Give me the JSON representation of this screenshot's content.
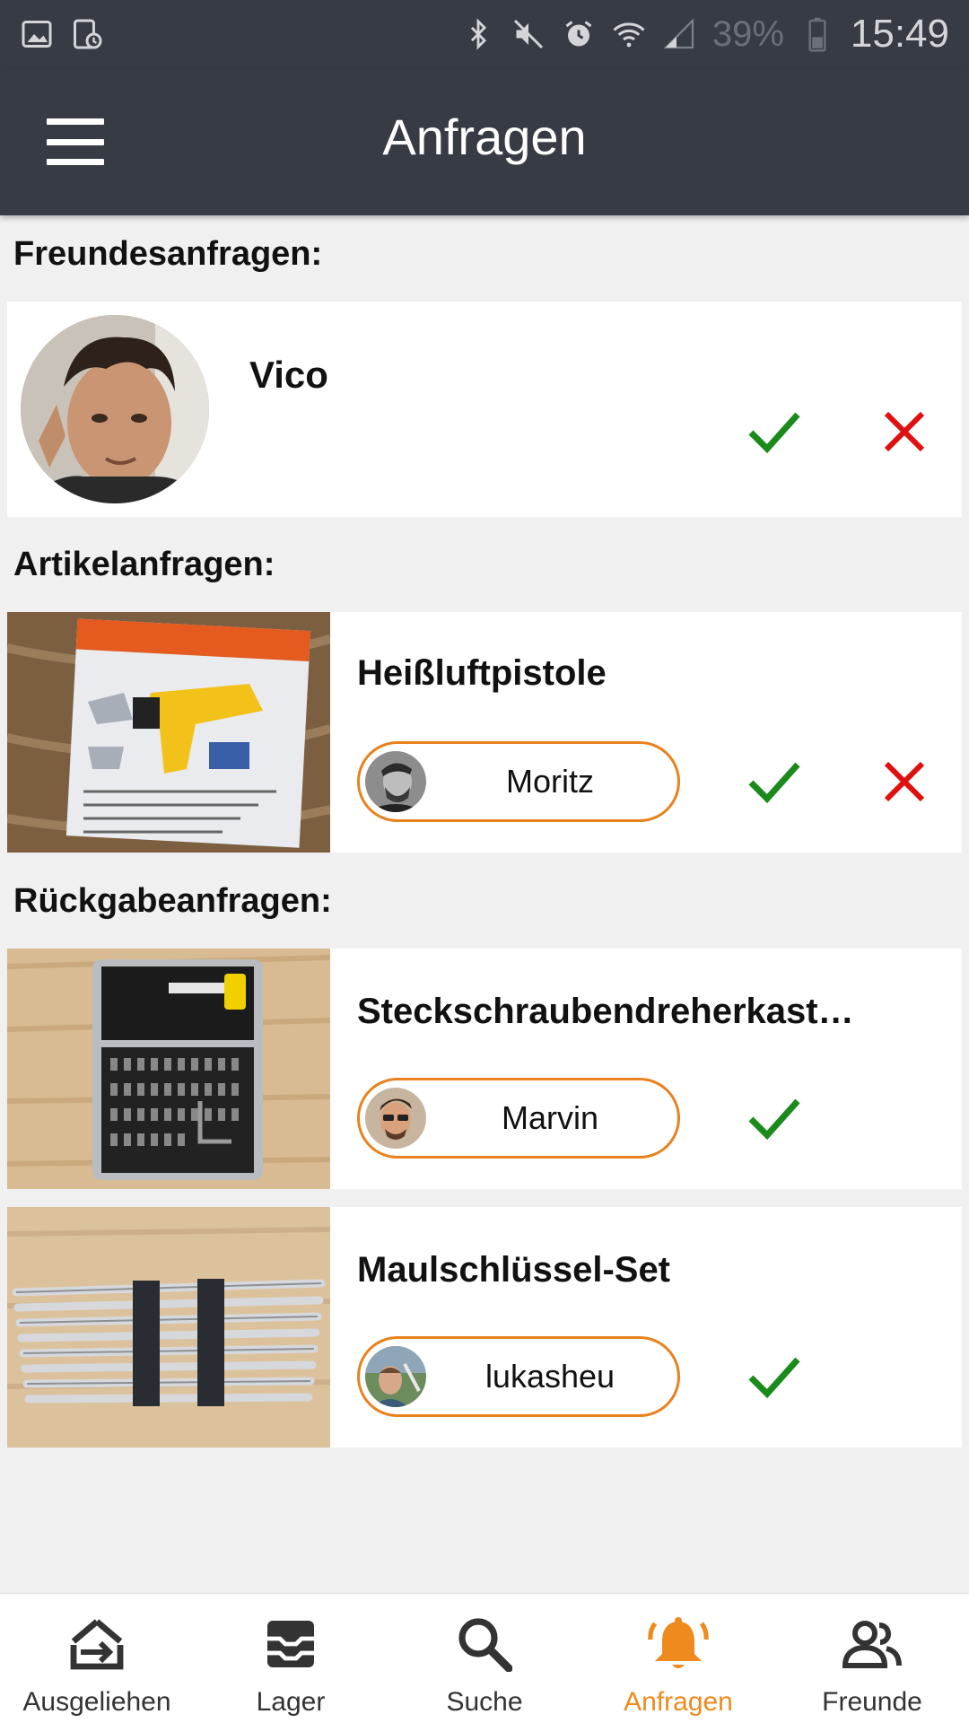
{
  "status_bar": {
    "battery": "39%",
    "time": "15:49"
  },
  "app_bar": {
    "title": "Anfragen"
  },
  "sections": {
    "friends": {
      "heading": "Freundesanfragen:",
      "items": [
        {
          "name": "Vico"
        }
      ]
    },
    "articles": {
      "heading": "Artikelanfragen:",
      "items": [
        {
          "title": "Heißluftpistole",
          "user": "Moritz"
        }
      ]
    },
    "returns": {
      "heading": "Rückgabeanfragen:",
      "items": [
        {
          "title": "Steckschraubendreherkast…",
          "user": "Marvin"
        },
        {
          "title": "Maulschlüssel-Set",
          "user": "lukasheu"
        }
      ]
    }
  },
  "bottom_nav": {
    "items": [
      {
        "label": "Ausgeliehen",
        "icon": "borrowed-icon"
      },
      {
        "label": "Lager",
        "icon": "storage-icon"
      },
      {
        "label": "Suche",
        "icon": "search-icon"
      },
      {
        "label": "Anfragen",
        "icon": "bell-icon"
      },
      {
        "label": "Freunde",
        "icon": "friends-icon"
      }
    ],
    "active_index": 3
  },
  "colors": {
    "app_bar": "#373b44",
    "accent": "#ee8a1e",
    "accept": "#1a8a1a",
    "decline": "#e01010"
  }
}
